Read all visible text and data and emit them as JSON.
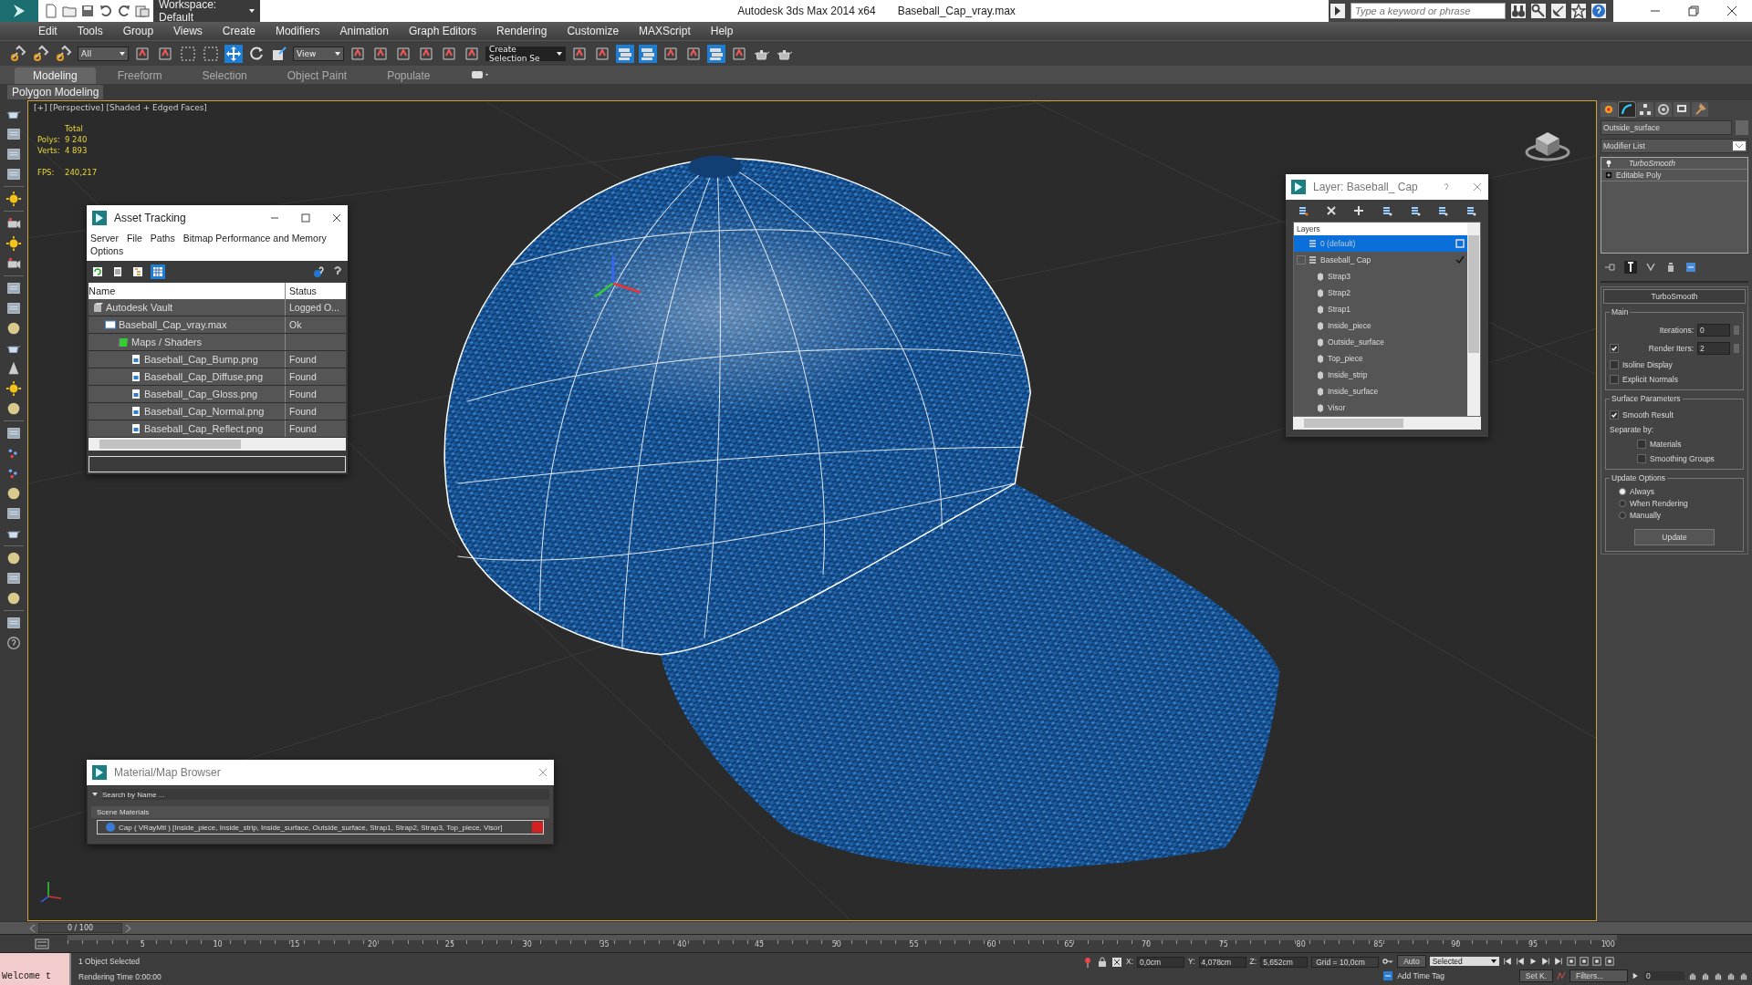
{
  "title_bar": {
    "workspace": "Workspace: Default",
    "title": "Autodesk 3ds Max  2014 x64",
    "file": "Baseball_Cap_vray.max",
    "search": {
      "placeholder": "Type a keyword or phrase"
    }
  },
  "menu": [
    "Edit",
    "Tools",
    "Group",
    "Views",
    "Create",
    "Modifiers",
    "Animation",
    "Graph Editors",
    "Rendering",
    "Customize",
    "MAXScript",
    "Help"
  ],
  "toolbar": {
    "selection_filter": "All",
    "reference_coord": "View",
    "named_selection": "Create Selection Se"
  },
  "ribbon": {
    "tabs": [
      {
        "label": "Modeling",
        "selected": true
      },
      {
        "label": "Freeform",
        "selected": false
      },
      {
        "label": "Selection",
        "selected": false
      },
      {
        "label": "Object Paint",
        "selected": false
      },
      {
        "label": "Populate",
        "selected": false
      }
    ],
    "panel": "Polygon Modeling"
  },
  "viewport": {
    "label": "[+] [Perspective] [Shaded + Edged Faces]",
    "stats_header": "Total",
    "stats": [
      {
        "label": "Polys:",
        "value": "9 240"
      },
      {
        "label": "Verts:",
        "value": "4 893"
      }
    ],
    "fps_label": "FPS:",
    "fps": "240,217"
  },
  "asset_tracking": {
    "title": "Asset Tracking",
    "menu": [
      "Server",
      "File",
      "Paths",
      "Bitmap Performance and Memory",
      "Options"
    ],
    "view_buttons": [
      {
        "kind": "refresh",
        "selected": false
      },
      {
        "kind": "list",
        "selected": false
      },
      {
        "kind": "tree",
        "selected": false
      },
      {
        "kind": "table",
        "selected": true
      }
    ],
    "columns": [
      "Name",
      "Status"
    ],
    "tree": [
      {
        "kind": "vault",
        "name": "Autodesk Vault",
        "status": "Logged O...",
        "children": [
          {
            "kind": "file",
            "name": "Baseball_Cap_vray.max",
            "status": "Ok",
            "children": [
              {
                "kind": "folder",
                "name": "Maps / Shaders",
                "children": [
                  {
                    "kind": "image",
                    "name": "Baseball_Cap_Bump.png",
                    "status": "Found"
                  },
                  {
                    "kind": "image",
                    "name": "Baseball_Cap_Diffuse.png",
                    "status": "Found"
                  },
                  {
                    "kind": "image",
                    "name": "Baseball_Cap_Gloss.png",
                    "status": "Found"
                  },
                  {
                    "kind": "image",
                    "name": "Baseball_Cap_Normal.png",
                    "status": "Found"
                  },
                  {
                    "kind": "image",
                    "name": "Baseball_Cap_Reflect.png",
                    "status": "Found"
                  }
                ]
              }
            ]
          }
        ]
      }
    ]
  },
  "layer_dialog": {
    "title": "Layer: Baseball_ Cap",
    "header": "Layers",
    "layers": [
      {
        "name": "0 (default)",
        "selected": true,
        "current": false
      },
      {
        "name": "Baseball_ Cap",
        "selected": false,
        "current": true,
        "expanded": true,
        "children": [
          {
            "name": "Strap3"
          },
          {
            "name": "Strap2"
          },
          {
            "name": "Strap1"
          },
          {
            "name": "Inside_piece"
          },
          {
            "name": "Outside_surface"
          },
          {
            "name": "Top_piece"
          },
          {
            "name": "Inside_strip"
          },
          {
            "name": "Inside_surface"
          },
          {
            "name": "Visor"
          }
        ]
      }
    ]
  },
  "material_browser": {
    "title": "Material/Map Browser",
    "search": {
      "placeholder": "Search by Name ..."
    },
    "group": "Scene Materials",
    "items": [
      {
        "name": "Cap ( VRayMtl ) [Inside_piece, Inside_strip, Inside_surface, Outside_surface, Strap1, Strap2, Strap3, Top_piece, Visor]",
        "color": "#d42020"
      }
    ]
  },
  "command_panel": {
    "tabs": [
      {
        "kind": "create",
        "selected": false
      },
      {
        "kind": "modify",
        "selected": true
      },
      {
        "kind": "hierarchy",
        "selected": false
      },
      {
        "kind": "motion",
        "selected": false
      },
      {
        "kind": "display",
        "selected": false
      },
      {
        "kind": "utilities",
        "selected": false
      }
    ],
    "object_name": "Outside_surface",
    "modifier_list": "Modifier List",
    "stack": [
      {
        "kind": "modifier",
        "name": "TurboSmooth"
      },
      {
        "kind": "base",
        "name": "Editable Poly"
      }
    ],
    "rollout": {
      "title": "TurboSmooth",
      "main": {
        "title": "Main",
        "iterations_label": "Iterations:",
        "iterations": "0",
        "render_iters_label": "Render Iters:",
        "render_iters": "2",
        "render_iters_checked": true,
        "options": [
          {
            "label": "Isoline Display",
            "checked": false
          },
          {
            "label": "Explicit Normals",
            "checked": false
          }
        ]
      },
      "surface": {
        "title": "Surface Parameters",
        "smooth_result": {
          "label": "Smooth Result",
          "checked": true
        },
        "separate_label": "Separate by:",
        "separate": [
          {
            "label": "Materials",
            "checked": false
          },
          {
            "label": "Smoothing Groups",
            "checked": false
          }
        ]
      },
      "update": {
        "title": "Update Options",
        "options": [
          {
            "label": "Always",
            "selected": true
          },
          {
            "label": "When Rendering",
            "selected": false
          },
          {
            "label": "Manually",
            "selected": false
          }
        ],
        "button": "Update"
      }
    }
  },
  "timeline": {
    "frame": "0 / 100",
    "level": 0,
    "ticks": [
      "5",
      "10",
      "15",
      "20",
      "25",
      "30",
      "35",
      "40",
      "45",
      "50",
      "55",
      "60",
      "65",
      "70",
      "75",
      "80",
      "85",
      "90",
      "95",
      "100"
    ]
  },
  "status": {
    "listener": "Welcome t",
    "selection": "1 Object Selected",
    "prompt": "Rendering Time  0:00:00",
    "x_label": "X:",
    "x": "0,0cm",
    "y_label": "Y:",
    "y": "4,078cm",
    "z_label": "Z:",
    "z": "5,652cm",
    "grid": "Grid = 10,0cm",
    "auto": "Auto",
    "set_key": "Set K.",
    "key_filter": "Selected",
    "add_time_tag": "Add Time Tag",
    "filters": "Filters...",
    "frame": "0"
  }
}
